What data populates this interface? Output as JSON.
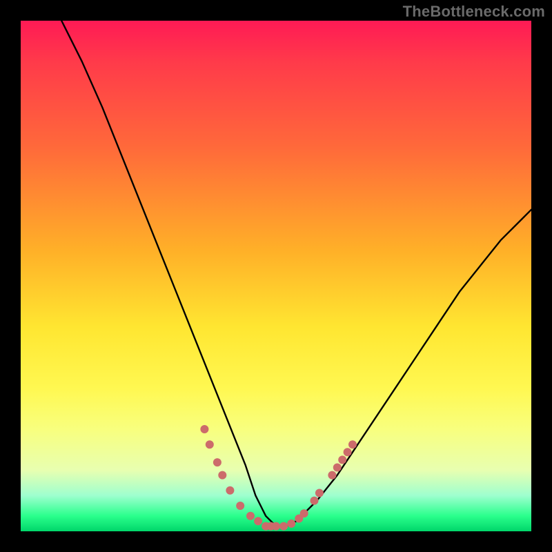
{
  "watermark": "TheBottleneck.com",
  "gradient_colors": {
    "top": "#ff1a55",
    "upper_mid": "#ffb028",
    "mid": "#ffe631",
    "lower_mid": "#f8ff7e",
    "near_bottom": "#9effcf",
    "bottom": "#00d66a"
  },
  "chart_data": {
    "type": "line",
    "title": "",
    "xlabel": "",
    "ylabel": "",
    "xlim": [
      0,
      100
    ],
    "ylim": [
      0,
      100
    ],
    "grid": false,
    "legend": false,
    "annotations": [],
    "series": [
      {
        "name": "bottleneck-curve",
        "color": "#000000",
        "x": [
          8,
          12,
          16,
          20,
          24,
          28,
          32,
          36,
          38,
          40,
          42,
          44,
          45,
          46,
          47,
          48,
          49,
          50,
          52,
          54,
          56,
          58,
          62,
          66,
          70,
          74,
          78,
          82,
          86,
          90,
          94,
          98,
          100
        ],
        "y": [
          100,
          92,
          83,
          73,
          63,
          53,
          43,
          33,
          28,
          23,
          18,
          13,
          10,
          7,
          5,
          3,
          2,
          1,
          1,
          2,
          4,
          6,
          11,
          17,
          23,
          29,
          35,
          41,
          47,
          52,
          57,
          61,
          63
        ]
      }
    ],
    "markers": [
      {
        "name": "highlight-dots",
        "color": "#cc6b6b",
        "shape": "circle",
        "radius": 6,
        "points": [
          {
            "x": 36.0,
            "y": 20.0
          },
          {
            "x": 37.0,
            "y": 17.0
          },
          {
            "x": 38.5,
            "y": 13.5
          },
          {
            "x": 39.5,
            "y": 11.0
          },
          {
            "x": 41.0,
            "y": 8.0
          },
          {
            "x": 43.0,
            "y": 5.0
          },
          {
            "x": 45.0,
            "y": 3.0
          },
          {
            "x": 46.5,
            "y": 2.0
          },
          {
            "x": 48.0,
            "y": 1.0
          },
          {
            "x": 49.0,
            "y": 1.0
          },
          {
            "x": 50.0,
            "y": 1.0
          },
          {
            "x": 51.5,
            "y": 1.0
          },
          {
            "x": 53.0,
            "y": 1.5
          },
          {
            "x": 54.5,
            "y": 2.5
          },
          {
            "x": 55.5,
            "y": 3.5
          },
          {
            "x": 57.5,
            "y": 6.0
          },
          {
            "x": 58.5,
            "y": 7.5
          },
          {
            "x": 61.0,
            "y": 11.0
          },
          {
            "x": 62.0,
            "y": 12.5
          },
          {
            "x": 63.0,
            "y": 14.0
          },
          {
            "x": 64.0,
            "y": 15.5
          },
          {
            "x": 65.0,
            "y": 17.0
          }
        ]
      }
    ]
  }
}
